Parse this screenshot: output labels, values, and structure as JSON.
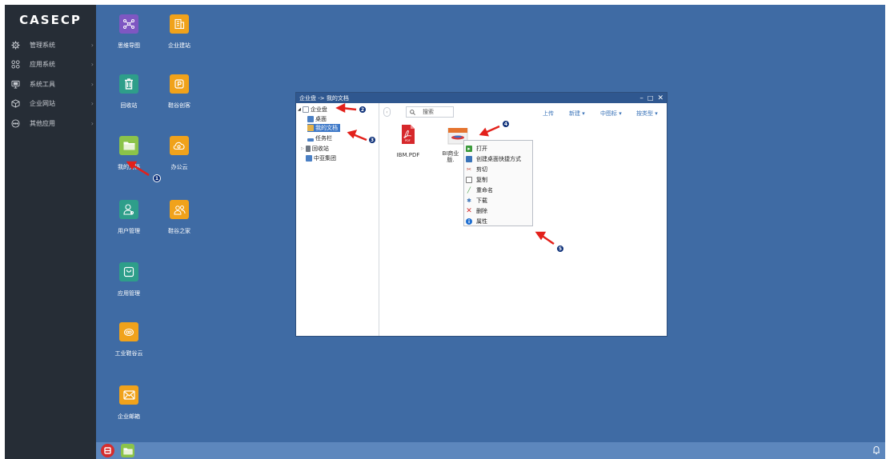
{
  "sidebar": {
    "logo": "CASECP",
    "items": [
      {
        "label": "管理系统",
        "icon": "gear-icon"
      },
      {
        "label": "应用系统",
        "icon": "apps-grid-icon"
      },
      {
        "label": "系统工具",
        "icon": "monitor-icon"
      },
      {
        "label": "企业网站",
        "icon": "cube-icon"
      },
      {
        "label": "其他应用",
        "icon": "more-circle-icon"
      }
    ]
  },
  "desktop": {
    "icons": [
      {
        "label": "思维导图",
        "icon": "mindmap-icon",
        "color": "#7e57c2"
      },
      {
        "label": "企业建站",
        "icon": "site-builder-icon",
        "color": "#f0a21b"
      },
      {
        "label": "回收站",
        "icon": "trash-icon",
        "color": "#2e9e8a"
      },
      {
        "label": "鞋谷创客",
        "icon": "maker-icon",
        "color": "#f0a21b"
      },
      {
        "label": "我的文档",
        "icon": "folder-icon",
        "color": "#8bc34a"
      },
      {
        "label": "办公云",
        "icon": "cloud-icon",
        "color": "#f0a21b"
      },
      {
        "label": "用户管理",
        "icon": "user-icon",
        "color": "#2e9e8a"
      },
      {
        "label": "鞋谷之家",
        "icon": "group-icon",
        "color": "#f0a21b"
      },
      {
        "label": "应用管理",
        "icon": "bag-icon",
        "color": "#2e9e8a"
      },
      {
        "label": "工业鞋谷云",
        "icon": "industry-cloud-icon",
        "color": "#f0a21b"
      },
      {
        "label": "企业邮箱",
        "icon": "mail-icon",
        "color": "#f0a21b"
      }
    ]
  },
  "explorer": {
    "title": "企业盘 -> 我的文档",
    "tree": [
      "企业盘",
      "桌面",
      "我的文档",
      "任务栏",
      "回收站",
      "中亚集团"
    ],
    "search_placeholder": "搜索",
    "toolbar": [
      "上传",
      "新建 ▾",
      "中图标 ▾",
      "按类型 ▾"
    ],
    "files": [
      {
        "name": "IBM.PDF",
        "type": "pdf"
      },
      {
        "name": "BI商业\n版.",
        "type": "doc"
      }
    ]
  },
  "context_menu": {
    "items": [
      {
        "label": "打开",
        "icon": "open-icon",
        "color": "#3a9a3a"
      },
      {
        "label": "创建桌面快捷方式",
        "icon": "shortcut-icon",
        "color": "#3a73b8"
      },
      {
        "label": "剪切",
        "icon": "cut-icon",
        "color": "#c0392b"
      },
      {
        "label": "复制",
        "icon": "copy-icon",
        "color": "#777777"
      },
      {
        "label": "重命名",
        "icon": "rename-icon",
        "color": "#3a9a3a"
      },
      {
        "label": "下载",
        "icon": "download-icon",
        "color": "#3a73b8"
      },
      {
        "label": "删除",
        "icon": "delete-icon",
        "color": "#d32f2f"
      },
      {
        "label": "属性",
        "icon": "info-icon",
        "color": "#1f6fd1"
      }
    ]
  },
  "badges": [
    "1",
    "2",
    "3",
    "4",
    "5"
  ],
  "taskbar": {
    "bell": "bell-icon"
  },
  "colors": {
    "desktop": "#3f6ba4",
    "sidebar": "#262d36",
    "taskbar": "#5d87bd",
    "title_bar": "#2f578f",
    "arrow": "#e3211b"
  }
}
